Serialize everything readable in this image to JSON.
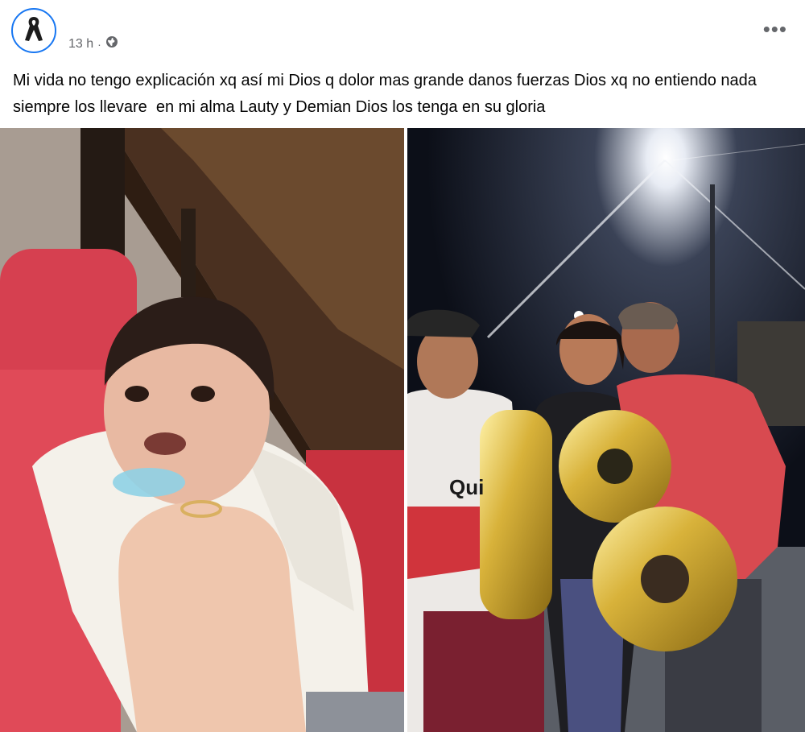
{
  "post": {
    "timestamp": "13 h",
    "separator": "·",
    "audience_icon": "globe-icon",
    "avatar_icon": "mourning-ribbon-icon",
    "more_icon": "more-options-icon",
    "more_label": "•••",
    "text": "Mi vida no tengo explicación xq así mi Dios q dolor mas grande danos fuerzas Dios xq no entiendo nada  siempre los llevare  en mi alma Lauty y Demian Dios los tenga en su gloria"
  },
  "photos": {
    "right_balloon_text": "18",
    "right_jersey_text": "Qui"
  },
  "colors": {
    "accent": "#1877f2",
    "meta_text": "#65676b",
    "balloon_gold": "#c9a227"
  }
}
